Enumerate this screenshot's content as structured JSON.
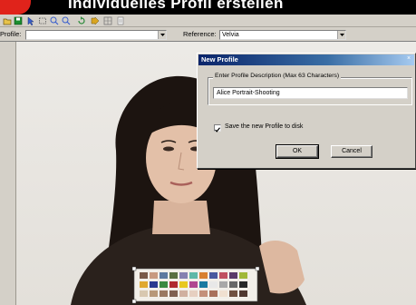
{
  "header": {
    "title": "Individuelles Profil erstellen"
  },
  "profile_bar": {
    "profile_label": "Profile:",
    "profile_value": "",
    "reference_label": "Reference:",
    "reference_value": "Velvia"
  },
  "dialog": {
    "title": "New Profile",
    "group_label": "Enter Profile Description (Max 63 Characters)",
    "description_value": "Alice Portrait-Shooting",
    "save_checkbox_label": "Save the new Profile to disk",
    "save_checked": true,
    "ok_label": "OK",
    "cancel_label": "Cancel"
  },
  "toolbar_icons": [
    "open-icon",
    "save-icon",
    "pointer-icon",
    "select-rect-icon",
    "zoom-in-icon",
    "zoom-out-icon",
    "rotate-icon",
    "forward-icon",
    "grid-icon",
    "undo-icon"
  ],
  "colors": {
    "header_bg": "#000000",
    "badge_red": "#e0231b",
    "dialog_title_start": "#0a246a",
    "dialog_title_end": "#a6caf0",
    "chrome": "#d4d0c8"
  }
}
